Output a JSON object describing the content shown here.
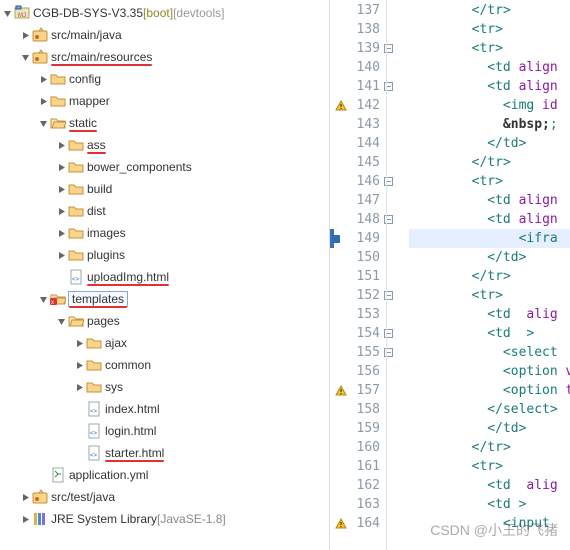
{
  "project": {
    "name": "CGB-DB-SYS-V3.35",
    "boot_suffix": "[boot]",
    "devtools_suffix": "[devtools]"
  },
  "tree": [
    {
      "depth": 0,
      "icon": "project",
      "expand": "open",
      "label": "CGB-DB-SYS-V3.35",
      "extra": "project"
    },
    {
      "depth": 1,
      "icon": "pkg",
      "expand": "closed",
      "label": "src/main/java"
    },
    {
      "depth": 1,
      "icon": "pkg",
      "expand": "open",
      "label": "src/main/resources",
      "red": true
    },
    {
      "depth": 2,
      "icon": "folder",
      "expand": "closed",
      "label": "config"
    },
    {
      "depth": 2,
      "icon": "folder",
      "expand": "closed",
      "label": "mapper"
    },
    {
      "depth": 2,
      "icon": "foldero",
      "expand": "open",
      "label": "static",
      "red": true
    },
    {
      "depth": 3,
      "icon": "folder",
      "expand": "closed",
      "label": "ass",
      "red": true
    },
    {
      "depth": 3,
      "icon": "folder",
      "expand": "closed",
      "label": "bower_components"
    },
    {
      "depth": 3,
      "icon": "folder",
      "expand": "closed",
      "label": "build"
    },
    {
      "depth": 3,
      "icon": "folder",
      "expand": "closed",
      "label": "dist"
    },
    {
      "depth": 3,
      "icon": "folder",
      "expand": "closed",
      "label": "images"
    },
    {
      "depth": 3,
      "icon": "folder",
      "expand": "closed",
      "label": "plugins"
    },
    {
      "depth": 3,
      "icon": "html",
      "expand": "none",
      "label": "uploadImg.html",
      "red": true
    },
    {
      "depth": 2,
      "icon": "folderoT",
      "expand": "open",
      "label": "templates",
      "red": true,
      "boxed": true
    },
    {
      "depth": 3,
      "icon": "foldero",
      "expand": "open",
      "label": "pages"
    },
    {
      "depth": 4,
      "icon": "folder",
      "expand": "closed",
      "label": "ajax"
    },
    {
      "depth": 4,
      "icon": "folder",
      "expand": "closed",
      "label": "common"
    },
    {
      "depth": 4,
      "icon": "folder",
      "expand": "closed",
      "label": "sys"
    },
    {
      "depth": 4,
      "icon": "html",
      "expand": "none",
      "label": "index.html"
    },
    {
      "depth": 4,
      "icon": "html",
      "expand": "none",
      "label": "login.html"
    },
    {
      "depth": 4,
      "icon": "html",
      "expand": "none",
      "label": "starter.html",
      "red": true
    },
    {
      "depth": 2,
      "icon": "yml",
      "expand": "none",
      "label": "application.yml"
    },
    {
      "depth": 1,
      "icon": "pkg",
      "expand": "closed",
      "label": "src/test/java"
    },
    {
      "depth": 1,
      "icon": "library",
      "expand": "closed",
      "label": "JRE System Library",
      "lib_suffix": "[JavaSE-1.8]"
    }
  ],
  "editor": {
    "lines": [
      {
        "n": 137,
        "indent": 4,
        "tokens": [
          [
            "</",
            "tag"
          ],
          [
            "tr",
            ""
          ],
          [
            ">",
            "tag"
          ]
        ]
      },
      {
        "n": 138,
        "indent": 4,
        "tokens": [
          [
            "<",
            "tag"
          ],
          [
            "tr",
            ""
          ],
          [
            ">",
            "tag"
          ]
        ]
      },
      {
        "n": 139,
        "fold": true,
        "indent": 4,
        "tokens": [
          [
            "<",
            "tag"
          ],
          [
            "tr",
            ""
          ],
          [
            ">",
            "tag"
          ]
        ]
      },
      {
        "n": 140,
        "indent": 5,
        "tokens": [
          [
            "<",
            "tag"
          ],
          [
            "td",
            ""
          ],
          [
            " align",
            "attr"
          ]
        ]
      },
      {
        "n": 141,
        "fold": true,
        "indent": 5,
        "tokens": [
          [
            "<",
            "tag"
          ],
          [
            "td",
            ""
          ],
          [
            " align",
            "attr"
          ]
        ]
      },
      {
        "n": 142,
        "warn": true,
        "indent": 6,
        "tokens": [
          [
            "<",
            "tag"
          ],
          [
            "img",
            ""
          ],
          [
            " id",
            "attr"
          ]
        ]
      },
      {
        "n": 143,
        "indent": 6,
        "tokens": [
          [
            "&nbsp;",
            "entity"
          ],
          [
            ";",
            ""
          ]
        ]
      },
      {
        "n": 144,
        "indent": 5,
        "tokens": [
          [
            "</",
            "tag"
          ],
          [
            "td",
            ""
          ],
          [
            ">",
            "tag"
          ]
        ]
      },
      {
        "n": 145,
        "indent": 4,
        "tokens": [
          [
            "</",
            "tag"
          ],
          [
            "tr",
            ""
          ],
          [
            ">",
            "tag"
          ]
        ]
      },
      {
        "n": 146,
        "fold": true,
        "indent": 4,
        "tokens": [
          [
            "<",
            "tag"
          ],
          [
            "tr",
            ""
          ],
          [
            ">",
            "tag"
          ]
        ]
      },
      {
        "n": 147,
        "indent": 5,
        "tokens": [
          [
            "<",
            "tag"
          ],
          [
            "td",
            ""
          ],
          [
            " align",
            "attr"
          ]
        ]
      },
      {
        "n": 148,
        "fold": true,
        "indent": 5,
        "tokens": [
          [
            "<",
            "tag"
          ],
          [
            "td",
            ""
          ],
          [
            " align",
            "attr"
          ]
        ]
      },
      {
        "n": 149,
        "selected": true,
        "bp": true,
        "indent": 7,
        "tokens": [
          [
            "<",
            "tag"
          ],
          [
            "ifra",
            ""
          ]
        ]
      },
      {
        "n": 150,
        "indent": 5,
        "tokens": [
          [
            "</",
            "tag"
          ],
          [
            "td",
            ""
          ],
          [
            ">",
            "tag"
          ]
        ]
      },
      {
        "n": 151,
        "indent": 4,
        "tokens": [
          [
            "</",
            "tag"
          ],
          [
            "tr",
            ""
          ],
          [
            ">",
            "tag"
          ]
        ]
      },
      {
        "n": 152,
        "fold": true,
        "indent": 4,
        "tokens": [
          [
            "<",
            "tag"
          ],
          [
            "tr",
            ""
          ],
          [
            ">",
            "tag"
          ]
        ]
      },
      {
        "n": 153,
        "indent": 5,
        "tokens": [
          [
            "<",
            "tag"
          ],
          [
            "td",
            ""
          ],
          [
            "  alig",
            "attr"
          ]
        ]
      },
      {
        "n": 154,
        "fold": true,
        "indent": 5,
        "tokens": [
          [
            "<",
            "tag"
          ],
          [
            "td",
            ""
          ],
          [
            "  >",
            "tag"
          ]
        ]
      },
      {
        "n": 155,
        "fold": true,
        "indent": 6,
        "tokens": [
          [
            "<",
            "tag"
          ],
          [
            "select",
            ""
          ],
          [
            " ",
            "attr"
          ]
        ]
      },
      {
        "n": 156,
        "indent": 6,
        "tokens": [
          [
            "<",
            "tag"
          ],
          [
            "option",
            ""
          ],
          [
            " v",
            "attr"
          ]
        ]
      },
      {
        "n": 157,
        "warn": true,
        "indent": 6,
        "tokens": [
          [
            "<",
            "tag"
          ],
          [
            "option",
            ""
          ],
          [
            " t",
            "attr"
          ]
        ]
      },
      {
        "n": 158,
        "indent": 5,
        "tokens": [
          [
            "</",
            "tag"
          ],
          [
            "select",
            ""
          ],
          [
            ">",
            "tag"
          ]
        ]
      },
      {
        "n": 159,
        "indent": 5,
        "tokens": [
          [
            "</",
            "tag"
          ],
          [
            "td",
            ""
          ],
          [
            ">",
            "tag"
          ]
        ]
      },
      {
        "n": 160,
        "indent": 4,
        "tokens": [
          [
            "</",
            "tag"
          ],
          [
            "tr",
            ""
          ],
          [
            ">",
            "tag"
          ]
        ]
      },
      {
        "n": 161,
        "indent": 4,
        "tokens": [
          [
            "<",
            "tag"
          ],
          [
            "tr",
            ""
          ],
          [
            ">",
            "tag"
          ]
        ]
      },
      {
        "n": 162,
        "indent": 5,
        "tokens": [
          [
            "<",
            "tag"
          ],
          [
            "td",
            ""
          ],
          [
            "  alig",
            "attr"
          ]
        ]
      },
      {
        "n": 163,
        "indent": 5,
        "tokens": [
          [
            "<",
            "tag"
          ],
          [
            "td",
            ""
          ],
          [
            " >",
            "tag"
          ]
        ]
      },
      {
        "n": 164,
        "warn": true,
        "indent": 6,
        "tokens": [
          [
            "<",
            "tag"
          ],
          [
            "input",
            ""
          ]
        ]
      }
    ]
  },
  "watermark": "CSDN @小王的飞猪"
}
